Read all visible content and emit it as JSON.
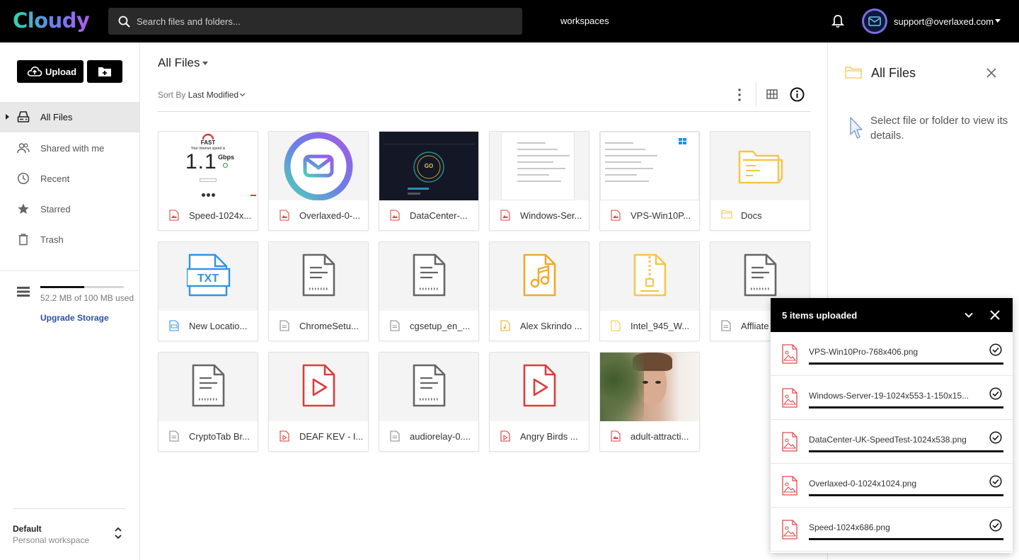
{
  "app": {
    "logo": "Cloudy"
  },
  "header": {
    "search_placeholder": "Search files and folders...",
    "workspaces_label": "workspaces",
    "user_email": "support@overlaxed.com"
  },
  "sidebar": {
    "upload_label": "Upload",
    "nav": [
      {
        "label": "All Files",
        "icon": "drive-icon",
        "active": true
      },
      {
        "label": "Shared with me",
        "icon": "people-icon",
        "active": false
      },
      {
        "label": "Recent",
        "icon": "clock-icon",
        "active": false
      },
      {
        "label": "Starred",
        "icon": "star-icon",
        "active": false
      },
      {
        "label": "Trash",
        "icon": "trash-icon",
        "active": false
      }
    ],
    "storage": {
      "used_text": "52.2 MB of 100 MB used",
      "used_fraction": 0.522
    },
    "upgrade_label": "Upgrade Storage",
    "workspace": {
      "name": "Default",
      "subtitle": "Personal workspace"
    }
  },
  "main": {
    "title": "All Files",
    "sort_prefix": "Sort By",
    "sort_value": "Last Modified",
    "files": [
      {
        "name": "Speed-1024x...",
        "kind": "image",
        "thumb": "speedtest"
      },
      {
        "name": "Overlaxed-0-...",
        "kind": "image",
        "thumb": "overlaxed"
      },
      {
        "name": "DataCenter-...",
        "kind": "image",
        "thumb": "datacenter"
      },
      {
        "name": "Windows-Ser...",
        "kind": "image",
        "thumb": "windows"
      },
      {
        "name": "VPS-Win10P...",
        "kind": "image",
        "thumb": "vps"
      },
      {
        "name": "Docs",
        "kind": "folder",
        "thumb": "folder"
      },
      {
        "name": "New Locatio...",
        "kind": "text",
        "thumb": "txt"
      },
      {
        "name": "ChromeSetu...",
        "kind": "doc",
        "thumb": "doc"
      },
      {
        "name": "cgsetup_en_...",
        "kind": "doc",
        "thumb": "doc"
      },
      {
        "name": "Alex Skrindo ...",
        "kind": "audio",
        "thumb": "audio"
      },
      {
        "name": "Intel_945_W...",
        "kind": "archive",
        "thumb": "zip"
      },
      {
        "name": "Affliate",
        "kind": "doc",
        "thumb": "doc"
      },
      {
        "name": "CryptoTab Br...",
        "kind": "doc",
        "thumb": "doc"
      },
      {
        "name": "DEAF KEV - I...",
        "kind": "video",
        "thumb": "video"
      },
      {
        "name": "audiorelay-0....",
        "kind": "doc",
        "thumb": "doc"
      },
      {
        "name": "Angry Birds ...",
        "kind": "video",
        "thumb": "video"
      },
      {
        "name": "adult-attracti...",
        "kind": "image",
        "thumb": "photo"
      }
    ],
    "speedtest_thumb": {
      "brand": "FAST",
      "caption": "Your Internet speed is",
      "value": "1.1",
      "unit": "Gbps"
    },
    "datacenter_thumb": {
      "button": "GO"
    },
    "txt_thumb": {
      "label": "TXT"
    }
  },
  "details": {
    "title": "All Files",
    "hint": "Select file or folder to view its details."
  },
  "uploads": {
    "title": "5 items uploaded",
    "items": [
      {
        "name": "VPS-Win10Pro-768x406.png",
        "progress": 1.0
      },
      {
        "name": "Windows-Server-19-1024x553-1-150x15...",
        "progress": 1.0
      },
      {
        "name": "DataCenter-UK-SpeedTest-1024x538.png",
        "progress": 1.0
      },
      {
        "name": "Overlaxed-0-1024x1024.png",
        "progress": 1.0
      },
      {
        "name": "Speed-1024x686.png",
        "progress": 1.0
      }
    ]
  },
  "colors": {
    "image_icon": "#e04a4a",
    "folder": "#f5c54a",
    "audio": "#f0a92a",
    "txt": "#2e93e8",
    "doc": "#666666",
    "video": "#e03a3a",
    "accent_link": "#2a4fa8"
  }
}
